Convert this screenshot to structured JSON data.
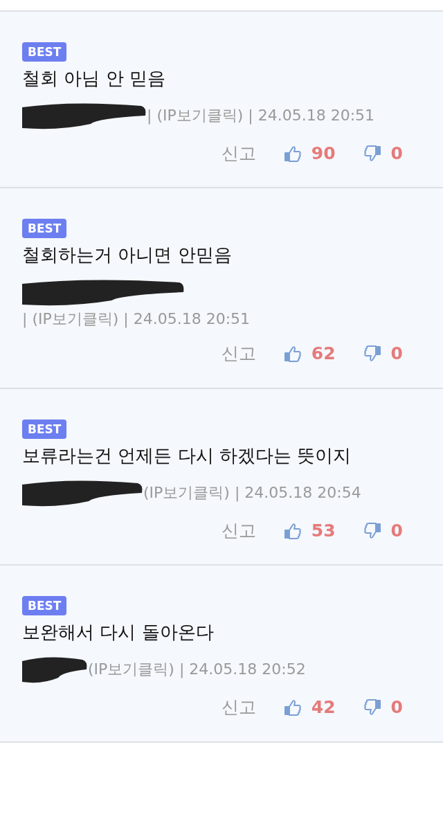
{
  "comments": [
    {
      "badge": "BEST",
      "text": "철회 아님 안 믿음",
      "author_redacted": true,
      "meta": "| (IP보기클릭) | 24.05.18 20:51",
      "report": "신고",
      "likes": "90",
      "dislikes": "0"
    },
    {
      "badge": "BEST",
      "text": "철회하는거 아니면 안믿음",
      "author_redacted": true,
      "meta": "| (IP보기클릭) | 24.05.18 20:51",
      "report": "신고",
      "likes": "62",
      "dislikes": "0"
    },
    {
      "badge": "BEST",
      "text": "보류라는건 언제든 다시 하겠다는 뜻이지",
      "author_redacted": true,
      "meta": "(IP보기클릭) | 24.05.18 20:54",
      "report": "신고",
      "likes": "53",
      "dislikes": "0"
    },
    {
      "badge": "BEST",
      "text": "보완해서 다시 돌아온다",
      "author_redacted": true,
      "meta": "(IP보기클릭) | 24.05.18 20:52",
      "report": "신고",
      "likes": "42",
      "dislikes": "0"
    }
  ]
}
